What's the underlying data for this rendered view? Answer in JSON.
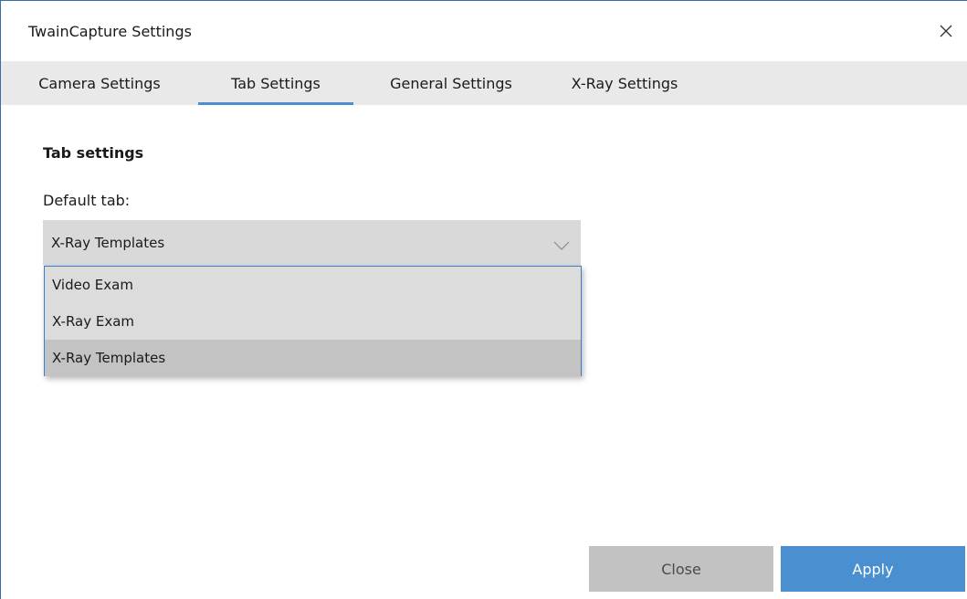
{
  "window": {
    "title": "TwainCapture Settings",
    "close_icon": "close-icon"
  },
  "tabs": [
    {
      "label": "Camera Settings",
      "active": false
    },
    {
      "label": "Tab Settings",
      "active": true
    },
    {
      "label": "General Settings",
      "active": false
    },
    {
      "label": "X-Ray Settings",
      "active": false
    }
  ],
  "content": {
    "section_title": "Tab settings",
    "default_tab_label": "Default tab:",
    "default_tab_value": "X-Ray Templates",
    "dropdown_icon": "chevron-down-icon",
    "options": [
      {
        "label": "Video Exam",
        "selected": false
      },
      {
        "label": "X-Ray Exam",
        "selected": false
      },
      {
        "label": "X-Ray Templates",
        "selected": true
      }
    ]
  },
  "buttons": {
    "close_label": "Close",
    "apply_label": "Apply"
  },
  "colors": {
    "accent": "#4a8fd0",
    "tab_bar_bg": "#e9e9e9",
    "combo_bg": "#d9d9d9",
    "dropdown_border": "#3d7ecb",
    "selected_option_bg": "#c3c3c3",
    "close_button_bg": "#c2c2c2"
  }
}
